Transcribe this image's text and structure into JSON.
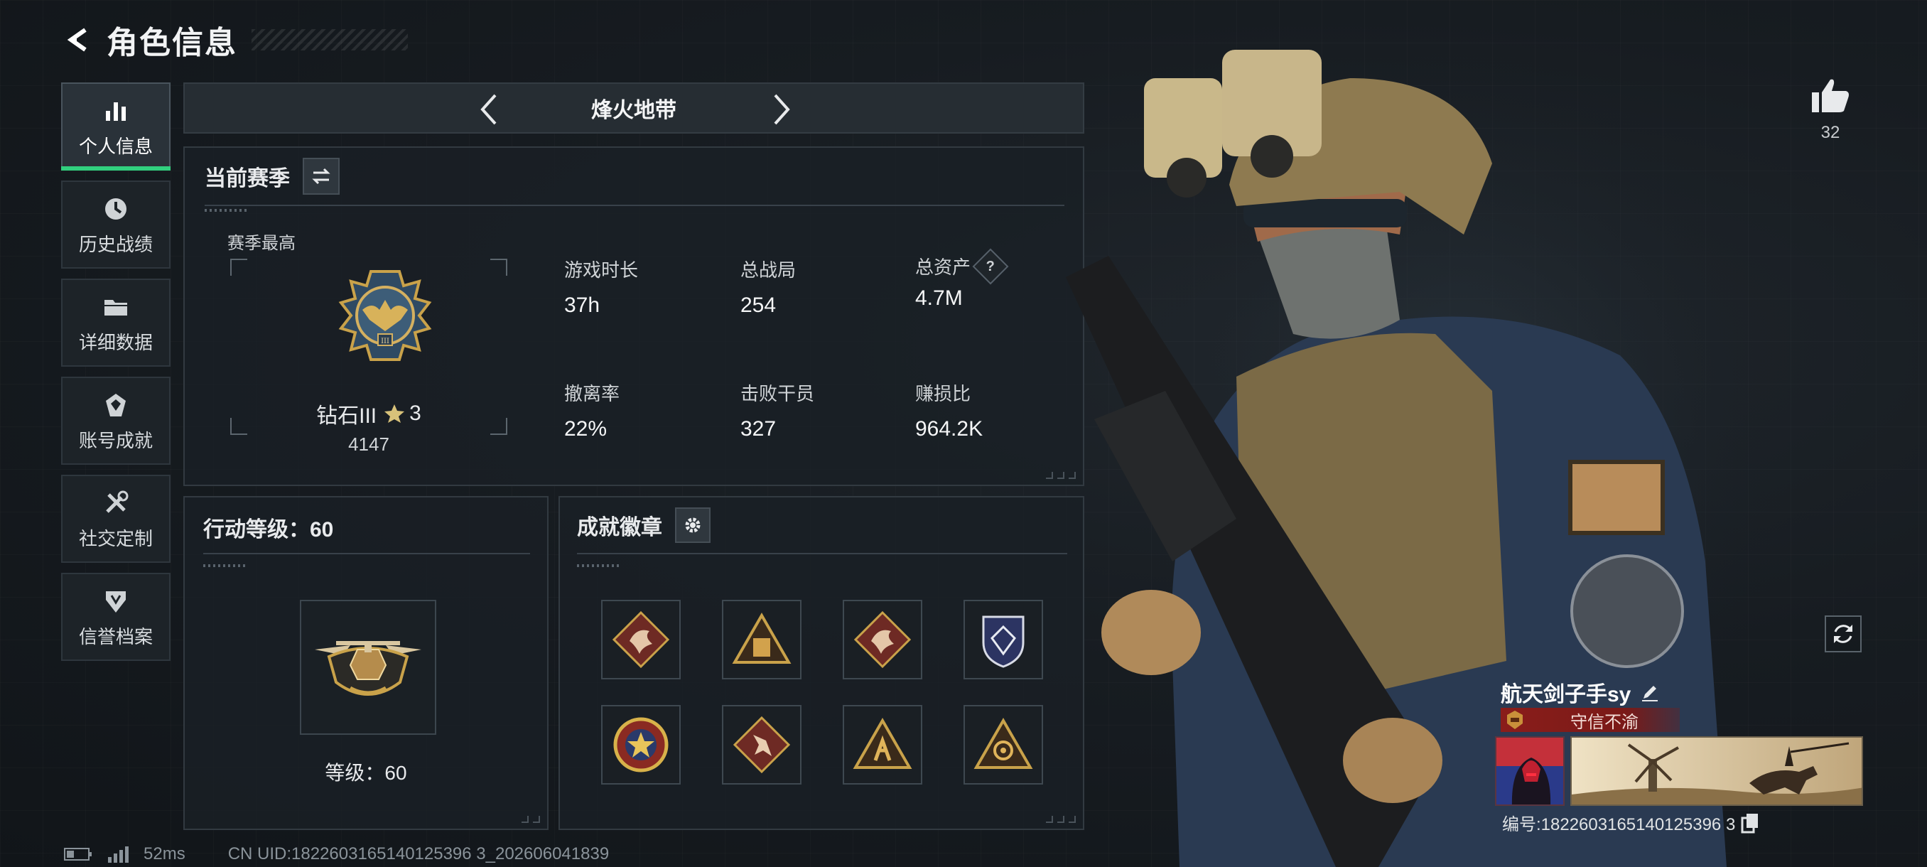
{
  "header": {
    "title": "角色信息"
  },
  "sidebar": {
    "items": [
      {
        "label": "个人信息",
        "icon": "bar-chart-icon",
        "active": true
      },
      {
        "label": "历史战绩",
        "icon": "clock-icon"
      },
      {
        "label": "详细数据",
        "icon": "folder-icon"
      },
      {
        "label": "账号成就",
        "icon": "achievement-icon"
      },
      {
        "label": "社交定制",
        "icon": "tools-icon"
      },
      {
        "label": "信誉档案",
        "icon": "shield-icon"
      }
    ]
  },
  "mode": {
    "title": "烽火地带"
  },
  "season": {
    "title": "当前赛季",
    "best_label": "赛季最高",
    "rank_name": "钻石III",
    "rank_stars": "3",
    "rank_score": "4147",
    "stats": [
      {
        "label": "游戏时长",
        "value": "37h"
      },
      {
        "label": "总战局",
        "value": "254"
      },
      {
        "label": "总资产",
        "value": "4.7M",
        "help": "?"
      },
      {
        "label": "撤离率",
        "value": "22%"
      },
      {
        "label": "击败干员",
        "value": "327"
      },
      {
        "label": "赚损比",
        "value": "964.2K"
      }
    ]
  },
  "level": {
    "title": "行动等级：60",
    "text": "等级：60"
  },
  "badges": {
    "title": "成就徽章",
    "items": [
      "dragon-badge-icon",
      "pyramid-badge-icon",
      "dragon-badge-icon",
      "crest-badge-icon",
      "star-medal-badge-icon",
      "runner-badge-icon",
      "pyramid-fighter-badge-icon",
      "eye-pyramid-badge-icon"
    ]
  },
  "status": {
    "ping": "52ms",
    "uid": "CN UID:1822603165140125396 3_202606041839"
  },
  "likes": {
    "count": "32"
  },
  "player": {
    "name": "航天剑子手sy",
    "title": "守信不渝",
    "id_text": "编号:1822603165140125396 3"
  },
  "colors": {
    "accent_green": "#31d07e",
    "banner_red": "#8a1d1a",
    "gold": "#c9a24a"
  }
}
